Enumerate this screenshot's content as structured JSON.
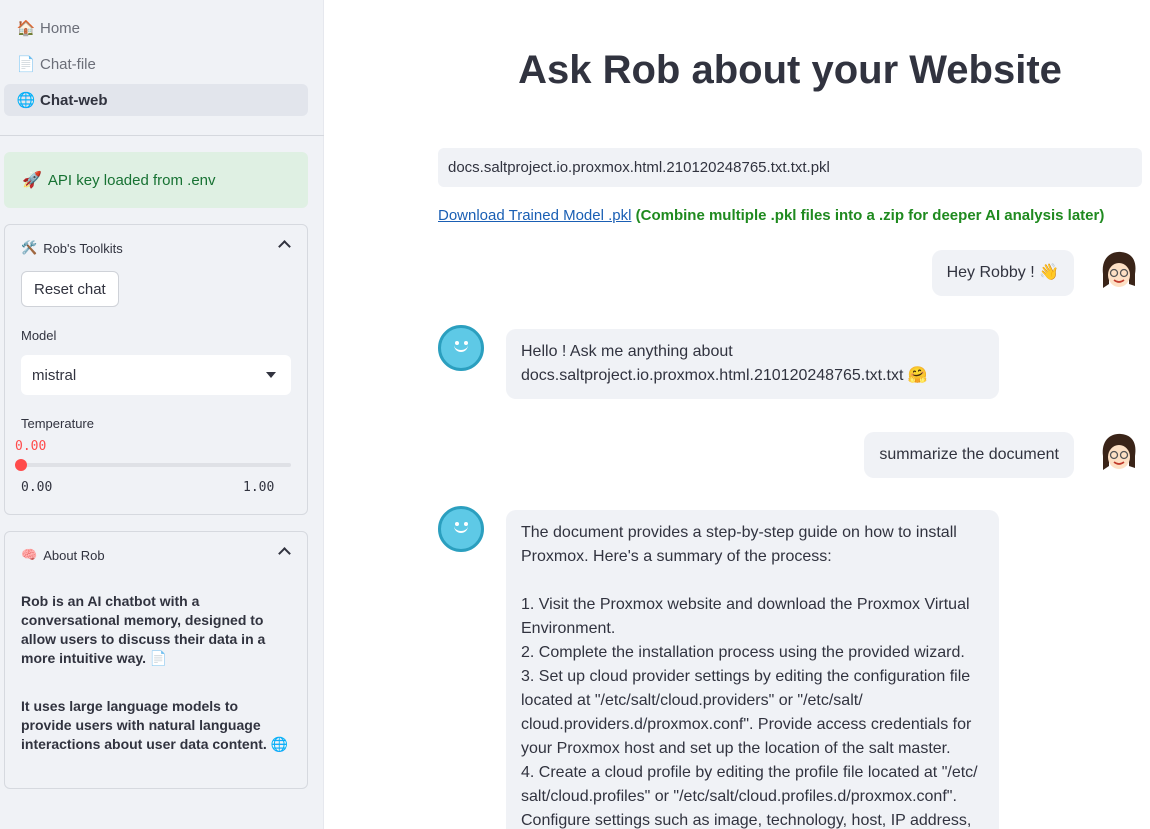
{
  "sidebar": {
    "nav": [
      {
        "icon": "house-icon",
        "glyph": "🏠",
        "label": "Home"
      },
      {
        "icon": "document-icon",
        "glyph": "📄",
        "label": "Chat-file"
      },
      {
        "icon": "globe-icon",
        "glyph": "🌐",
        "label": "Chat-web",
        "active": true
      }
    ],
    "alert": {
      "icon": "rocket-icon",
      "glyph": "🚀",
      "text": "API key loaded from .env"
    },
    "toolkits": {
      "icon": "tools-icon",
      "glyph": "🛠️",
      "title": "Rob's Toolkits",
      "reset_label": "Reset chat",
      "model_label": "Model",
      "model_value": "mistral",
      "temperature_label": "Temperature",
      "temperature_value": "0.00",
      "temperature_fraction": 0.0,
      "temperature_min": "0.00",
      "temperature_max": "1.00"
    },
    "about": {
      "icon": "brain-icon",
      "glyph": "🧠",
      "title": "About Rob",
      "para1": "Rob is an AI chatbot with a conversational memory, designed to allow users to discuss their data in a more intuitive way.",
      "para1_glyph": "📄",
      "para2": "It uses large language models to provide users with natural language interactions about user data content.",
      "para2_glyph": "🌐"
    }
  },
  "main": {
    "title": "Ask Rob about your Website",
    "file_name": "docs.saltproject.io.proxmox.html.210120248765.txt.txt.pkl",
    "download_link": "Download Trained Model .pkl",
    "download_hint": "(Combine multiple .pkl files into a .zip for deeper AI analysis later)",
    "messages": [
      {
        "role": "user",
        "text": "Hey Robby ! 👋"
      },
      {
        "role": "assistant",
        "text": "Hello ! Ask me anything about\ndocs.saltproject.io.proxmox.html.210120248765.txt.txt 🤗"
      },
      {
        "role": "user",
        "text": "summarize the document"
      },
      {
        "role": "assistant",
        "text": "The document provides a step-by-step guide on how to install Proxmox. Here's a summary of the process:\n\n1. Visit the Proxmox website and download the Proxmox Virtual Environment.\n2. Complete the installation process using the provided wizard.\n3. Set up cloud provider settings by editing the configuration file located at \"/etc/salt/cloud.providers\" or \"/etc/salt/\ncloud.providers.d/proxmox.conf\". Provide access credentials for your Proxmox host and set up the location of the salt master.\n4. Create a cloud profile by editing the profile file located at \"/etc/\nsalt/cloud.profiles\" or \"/etc/salt/cloud.profiles.d/proxmox.conf\".\nConfigure settings such as image, technology, host, IP address,"
      }
    ]
  }
}
